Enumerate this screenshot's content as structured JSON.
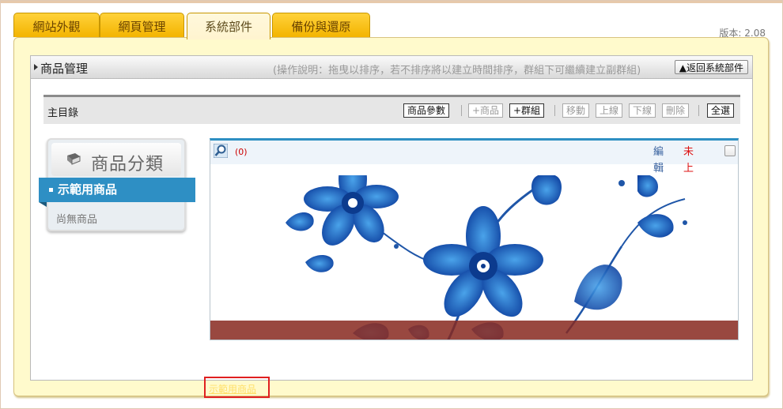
{
  "tabs": [
    {
      "label": "網站外觀",
      "active": false
    },
    {
      "label": "網頁管理",
      "active": false
    },
    {
      "label": "系統部件",
      "active": true
    },
    {
      "label": "備份與還原",
      "active": false
    }
  ],
  "version": "版本: 2.08",
  "panel": {
    "title": "商品管理",
    "description": "(操作說明：拖曳以排序，若不排序將以建立時間排序，群組下可繼續建立副群組)",
    "back_button": "▲返回系統部件"
  },
  "toolbar": {
    "label": "主目錄",
    "buttons": {
      "params": "商品參數",
      "add_product": "+商品",
      "add_group": "+群組",
      "move": "移動",
      "online": "上線",
      "offline": "下線",
      "delete": "刪除",
      "select_all": "全選"
    }
  },
  "category": {
    "title": "商品分類",
    "active_item": "示範用商品",
    "empty_text": "尚無商品"
  },
  "card": {
    "count": "(0)",
    "edit": "編輯",
    "offline": "未上線",
    "caption": "示範用商品",
    "checked": false
  },
  "colors": {
    "tab": "#f3b400",
    "panel_bg": "#fffacc",
    "accent": "#2e8fc4",
    "caption_bar": "#87281e",
    "highlight": "#e02020"
  },
  "icons": [
    "book-icon",
    "search-icon",
    "caret-right-icon",
    "checkbox-icon"
  ]
}
